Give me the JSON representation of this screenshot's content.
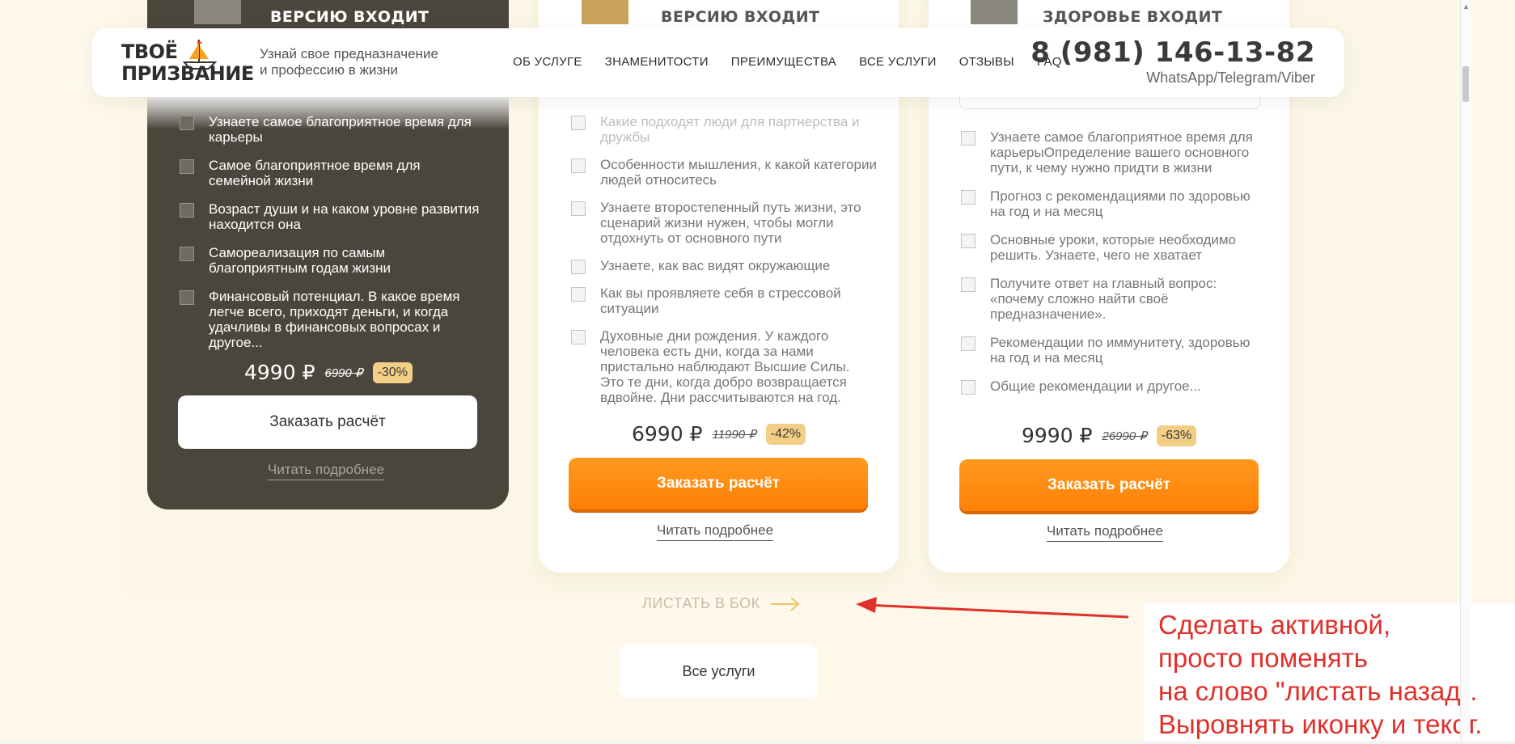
{
  "header": {
    "logo_line1": "ТВОЁ",
    "logo_line2": "ПРИЗВАНИЕ",
    "tagline_line1": "Узнай свое предназначение",
    "tagline_line2": "и профессию в жизни",
    "nav": [
      "ОБ УСЛУГЕ",
      "ЗНАМЕНИТОСТИ",
      "ПРЕИМУЩЕСТВА",
      "ВСЕ УСЛУГИ",
      "ОТЗЫВЫ",
      "FAQ"
    ],
    "phone": "8 (981) 146-13-82",
    "messengers": "WhatsApp/Telegram/Viber"
  },
  "cards": [
    {
      "heading": "ВЕРСИЮ ВХОДИТ",
      "features": [
        "Узнаете самое благоприятное время для карьеры",
        "Самое благоприятное время для семейной жизни",
        "Возраст души и на каком уровне развития находится она",
        "Самореализация по самым благоприятным годам жизни",
        "Финансовый потенциал. В какое время легче всего, приходят деньги, и когда удачливы в финансовых вопросах и другое..."
      ],
      "price": "4990 ₽",
      "old_price": "6990 ₽",
      "discount": "-30%",
      "button": "Заказать расчёт",
      "more": "Читать подробнее"
    },
    {
      "heading": "ВЕРСИЮ ВХОДИТ",
      "features": [
        "Какие подходят люди для партнерства и дружбы",
        "Особенности мышления, к какой категории людей относитесь",
        "Узнаете второстепенный путь жизни, это сценарий жизни нужен, чтобы могли отдохнуть от основного пути",
        "Узнаете, как вас видят окружающие",
        "Как вы проявляете себя в стрессовой ситуации",
        "Духовные дни рождения. У каждого человека есть дни, когда за нами пристально наблюдают Высшие Силы. Это те дни, когда добро возвращается вдвойне.  Дни рассчитываются на год."
      ],
      "price": "6990 ₽",
      "old_price": "11990 ₽",
      "discount": "-42%",
      "button": "Заказать расчёт",
      "more": "Читать подробнее"
    },
    {
      "heading": "ЗДОРОВЬЕ ВХОДИТ",
      "features": [
        "Узнаете самое благоприятное время для карьерыОпределение вашего основного пути, к чему нужно придти в жизни",
        "Прогноз с рекомендациями по здоровью на год и на месяц",
        "Основные уроки, которые необходимо решить. Узнаете, чего не хватает",
        "Получите ответ на главный вопрос: «почему сложно найти своё предназначение».",
        "Рекомендации по иммунитету, здоровью на год и на месяц",
        "Общие рекомендации и другое..."
      ],
      "price": "9990 ₽",
      "old_price": "26990 ₽",
      "discount": "-63%",
      "button": "Заказать расчёт",
      "more": "Читать подробнее"
    }
  ],
  "swipe_label": "ЛИСТАТЬ В БОК",
  "all_services_button": "Все услуги",
  "annotation_note": [
    "Сделать активной,",
    "просто поменять",
    "на слово \"листать назад\".",
    "Выровнять иконку и текст."
  ],
  "colors": {
    "accent_orange": "#ff8a10",
    "dark_card": "#4a463c",
    "badge": "#f3cf86",
    "annotation_red": "#e0302a",
    "background": "#fdf8e9"
  },
  "icons": [
    "boat-logo-icon",
    "feature-image-placeholder-icon",
    "arrow-right-icon",
    "red-annotation-arrow-icon"
  ]
}
